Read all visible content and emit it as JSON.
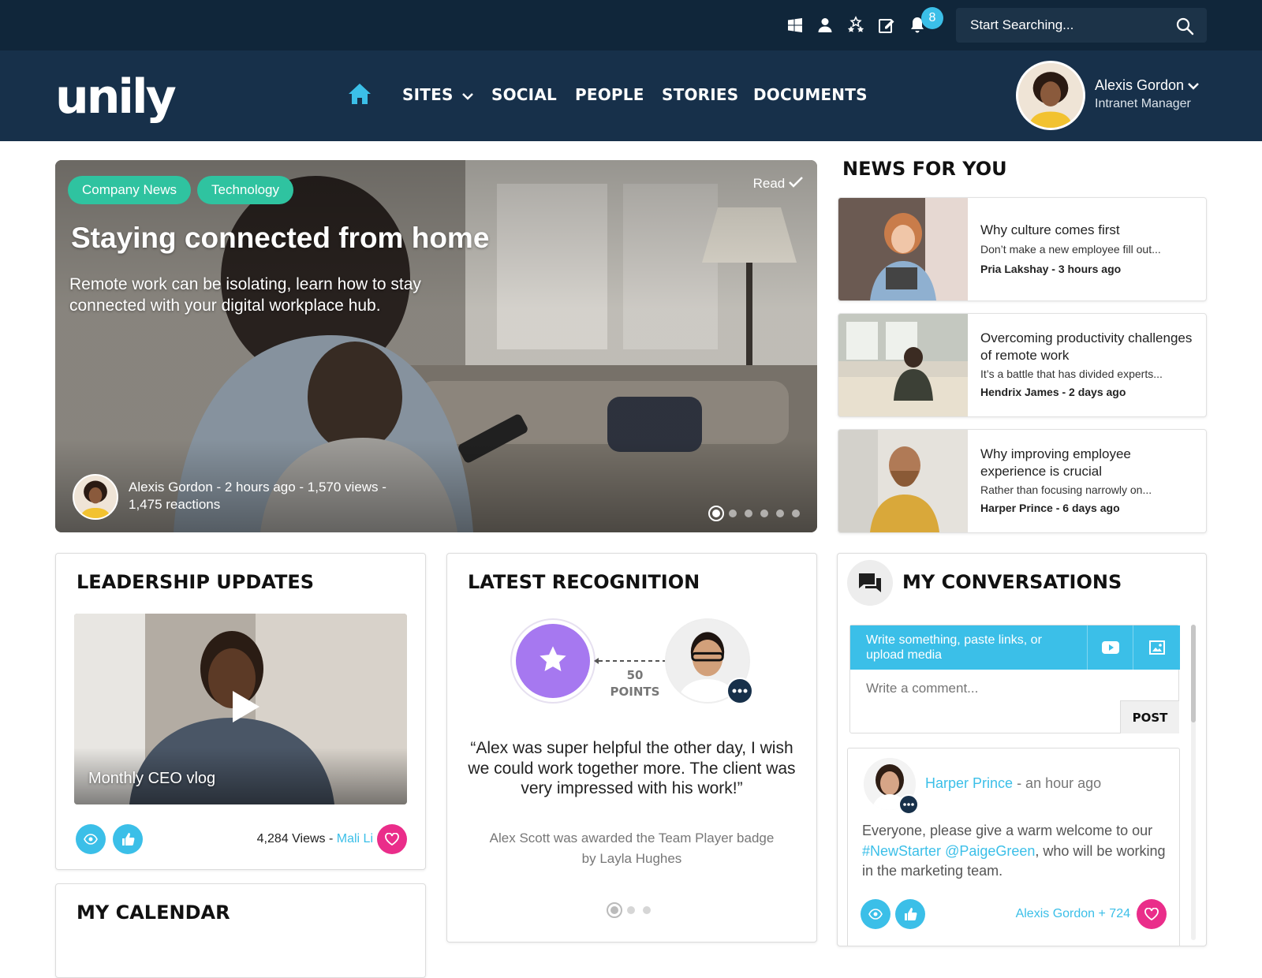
{
  "topbar": {
    "icons": [
      "windows-icon",
      "user-icon",
      "stars-icon",
      "edit-icon",
      "bell-icon"
    ],
    "notification_count": "8",
    "search_placeholder": "Start Searching..."
  },
  "brand": {
    "logo": "unily"
  },
  "nav": {
    "items": [
      "SITES",
      "SOCIAL",
      "PEOPLE",
      "STORIES",
      "DOCUMENTS"
    ]
  },
  "user": {
    "name": "Alexis Gordon",
    "role": "Intranet Manager"
  },
  "hero": {
    "tags": [
      "Company News",
      "Technology"
    ],
    "read_label": "Read",
    "title": "Staying connected from home",
    "subtitle": "Remote work can be isolating, learn how to stay connected with your digital workplace hub.",
    "meta_line1": "Alexis Gordon - 2 hours ago  - 1,570 views -",
    "meta_line2": "1,475 reactions",
    "slides": 6,
    "active_slide": 1
  },
  "news": {
    "title": "NEWS FOR YOU",
    "items": [
      {
        "title": "Why culture comes first",
        "excerpt": "Don’t make a new employee fill out...",
        "meta": "Pria Lakshay - 3 hours ago"
      },
      {
        "title": "Overcoming productivity challenges of remote work",
        "excerpt": "It’s a battle that has divided experts...",
        "meta": "Hendrix James - 2 days ago"
      },
      {
        "title": "Why improving employee experience is crucial",
        "excerpt": "Rather than focusing narrowly on...",
        "meta": "Harper Prince - 6 days ago"
      }
    ]
  },
  "leadership": {
    "title": "LEADERSHIP UPDATES",
    "video_caption": "Monthly CEO vlog",
    "views": "4,284 Views -",
    "author": "Mali Li"
  },
  "calendar": {
    "title": "MY CALENDAR"
  },
  "recognition": {
    "title": "LATEST RECOGNITION",
    "points_value": "50",
    "points_label": "POINTS",
    "quote": "“Alex was super helpful the other day, I wish we could work together more. The client was very impressed with his work!”",
    "award": "Alex Scott was awarded the Team Player badge by Layla Hughes",
    "slides": 3
  },
  "conversations": {
    "title": "MY CONVERSATIONS",
    "compose_placeholder": "Write something, paste links, or upload media",
    "comment_placeholder": "Write a comment...",
    "post_label": "POST",
    "post": {
      "author": "Harper Prince",
      "time": "- an hour ago",
      "text_before": "Everyone, please give a warm welcome to our ",
      "hashtag": "#NewStarter",
      "mention": "@PaigeGreen",
      "text_after": ", who will be working in the marketing team.",
      "reactions": "Alexis Gordon + 724"
    }
  },
  "colors": {
    "topbar": "#10263a",
    "navbar": "#17304a",
    "accent": "#3bbfe8",
    "tag_green": "#2fc3a0",
    "heart_pink": "#ea2d8a",
    "badge_purple": "#a678f0"
  }
}
